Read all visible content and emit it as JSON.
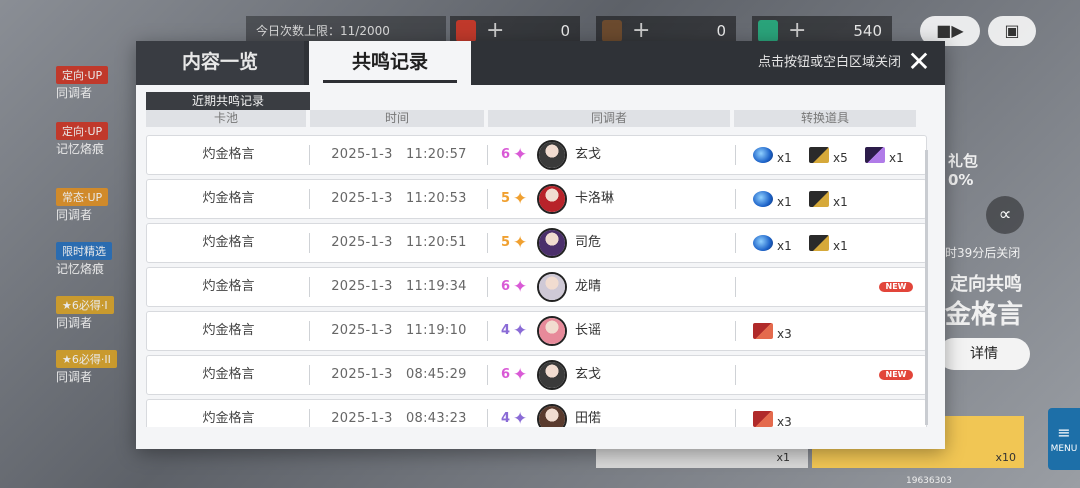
{
  "background": {
    "quota_text": "今日次数上限：11/2000",
    "res1_value": "0",
    "res2_value": "0",
    "res3_value": "540",
    "side_tags": [
      "定向·UP",
      "定向·UP",
      "常态·UP",
      "限时精选",
      "★6必得·I",
      "★6必得·II"
    ],
    "side_labels": [
      "同调者",
      "记忆烙痕",
      "同调者",
      "记忆烙痕",
      "同调者",
      "同调者"
    ],
    "right_banner_line1": "礼包",
    "right_banner_line2": "0%",
    "right_close_text": "时39分后关闭",
    "right_title1": "定向共鸣",
    "right_title2": "金格言",
    "detail_button": "详情",
    "bottom_gray_qty": "x1",
    "bottom_gold_qty": "x10",
    "menu_label": "MENU",
    "uid": "19636303"
  },
  "modal": {
    "tab_contents": "内容一览",
    "tab_records": "共鸣记录",
    "close_hint": "点击按钮或空白区域关闭",
    "close_icon": "✕",
    "section_label": "近期共鸣记录",
    "columns": [
      "卡池",
      "时间",
      "同调者",
      "转换道具"
    ]
  },
  "records": [
    {
      "pool": "灼金格言",
      "date": "2025-1-3",
      "time": "11:20:57",
      "rarity": "6",
      "star_color": "#d95ad6",
      "name": "玄戈",
      "avatar_color": "#3a3a3a",
      "items": [
        {
          "icon": "orb",
          "qty": "x1"
        },
        {
          "icon": "gold-ticket",
          "qty": "x5"
        },
        {
          "icon": "purple-ticket",
          "qty": "x1"
        }
      ],
      "new": false
    },
    {
      "pool": "灼金格言",
      "date": "2025-1-3",
      "time": "11:20:53",
      "rarity": "5",
      "star_color": "#f0a030",
      "name": "卡洛琳",
      "avatar_color": "#b8232a",
      "items": [
        {
          "icon": "orb",
          "qty": "x1"
        },
        {
          "icon": "gold-ticket",
          "qty": "x1"
        }
      ],
      "new": false
    },
    {
      "pool": "灼金格言",
      "date": "2025-1-3",
      "time": "11:20:51",
      "rarity": "5",
      "star_color": "#f0a030",
      "name": "司危",
      "avatar_color": "#4b2f6b",
      "items": [
        {
          "icon": "orb",
          "qty": "x1"
        },
        {
          "icon": "gold-ticket",
          "qty": "x1"
        }
      ],
      "new": false
    },
    {
      "pool": "灼金格言",
      "date": "2025-1-3",
      "time": "11:19:34",
      "rarity": "6",
      "star_color": "#d95ad6",
      "name": "龙晴",
      "avatar_color": "#cfc9d6",
      "items": [],
      "new": true
    },
    {
      "pool": "灼金格言",
      "date": "2025-1-3",
      "time": "11:19:10",
      "rarity": "4",
      "star_color": "#8a6bd6",
      "name": "长谣",
      "avatar_color": "#e78a9a",
      "items": [
        {
          "icon": "red-ticket",
          "qty": "x3"
        }
      ],
      "new": false
    },
    {
      "pool": "灼金格言",
      "date": "2025-1-3",
      "time": "08:45:29",
      "rarity": "6",
      "star_color": "#d95ad6",
      "name": "玄戈",
      "avatar_color": "#3a3a3a",
      "items": [],
      "new": true
    },
    {
      "pool": "灼金格言",
      "date": "2025-1-3",
      "time": "08:43:23",
      "rarity": "4",
      "star_color": "#8a6bd6",
      "name": "田偌",
      "avatar_color": "#5a3b2e",
      "items": [
        {
          "icon": "red-ticket",
          "qty": "x3"
        }
      ],
      "new": false
    }
  ],
  "new_badge_text": "NEW",
  "colors": {
    "header_bg": "#2f3237",
    "rarity6": "#d95ad6",
    "rarity5": "#f0a030",
    "rarity4": "#8a6bd6",
    "new_badge": "#e2453a"
  }
}
